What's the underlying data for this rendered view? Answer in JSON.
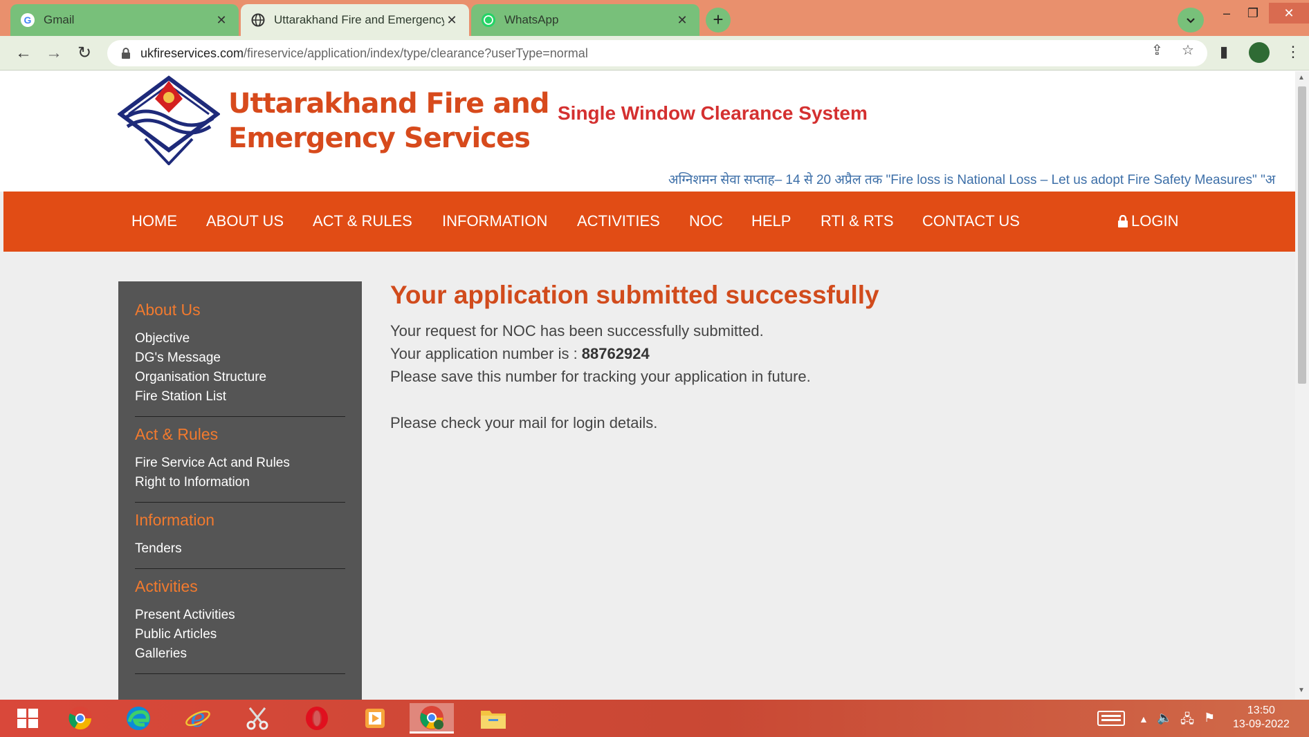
{
  "browser": {
    "tabs": [
      {
        "title": "Gmail",
        "icon": "google-icon"
      },
      {
        "title": "Uttarakhand Fire and Emergency",
        "icon": "globe-icon"
      },
      {
        "title": "WhatsApp",
        "icon": "whatsapp-icon"
      }
    ],
    "close_glyph": "✕",
    "url_host": "ukfireservices.com",
    "url_path": "/fireservice/application/index/type/clearance?userType=normal"
  },
  "site": {
    "title_line1": "Uttarakhand Fire and",
    "title_line2": "Emergency Services",
    "subtitle": "Single Window Clearance System",
    "marquee": "अग्निशमन सेवा सप्ताह– 14 से 20 अप्रैल तक \"Fire loss is National Loss – Let us adopt Fire Safety Measures\" \"अ"
  },
  "nav": {
    "items": [
      "HOME",
      "ABOUT US",
      "ACT & RULES",
      "INFORMATION",
      "ACTIVITIES",
      "NOC",
      "HELP",
      "RTI & RTS",
      "CONTACT US"
    ],
    "login": "LOGIN"
  },
  "sidebar": {
    "groups": [
      {
        "heading": "About Us",
        "links": [
          "Objective",
          "DG's Message",
          "Organisation Structure",
          "Fire Station List"
        ]
      },
      {
        "heading": "Act & Rules",
        "links": [
          "Fire Service Act and Rules",
          "Right to Information"
        ]
      },
      {
        "heading": "Information",
        "links": [
          "Tenders"
        ]
      },
      {
        "heading": "Activities",
        "links": [
          "Present Activities",
          "Public Articles",
          "Galleries"
        ]
      }
    ]
  },
  "message": {
    "title": "Your application submitted successfully",
    "line1": "Your request for NOC has been successfully submitted.",
    "line2_prefix": "Your application number is : ",
    "application_number": "88762924",
    "line3": "Please save this number for tracking your application in future.",
    "line4": "Please check your mail for login details."
  },
  "taskbar": {
    "time": "13:50",
    "date": "13-09-2022"
  },
  "colors": {
    "brand_orange": "#e14c15",
    "title_orange": "#d14b1c",
    "sidebar_bg": "#555555",
    "sidebar_heading": "#f27a2e"
  }
}
